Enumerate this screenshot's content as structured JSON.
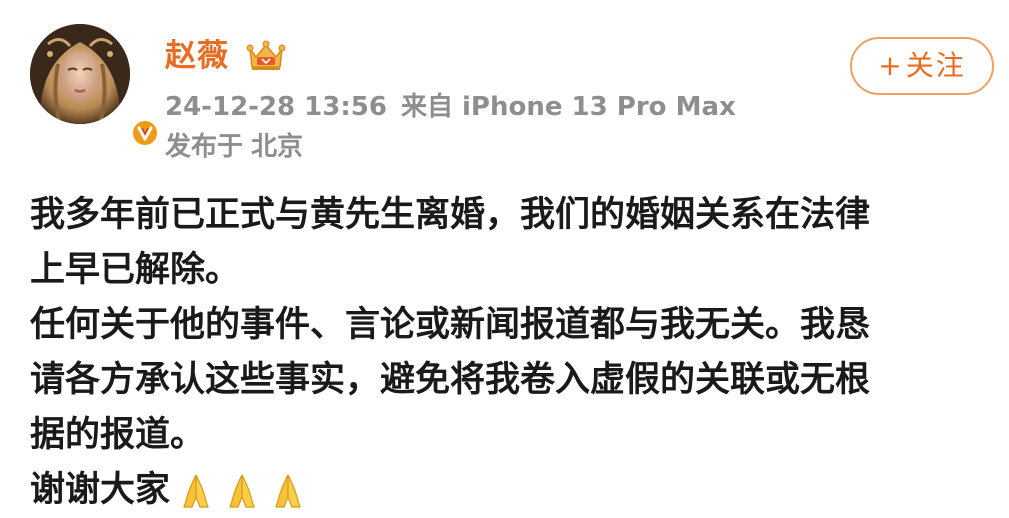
{
  "post": {
    "author": {
      "name": "赵薇",
      "avatar_icon": "avatar-image",
      "verified_icon": "verified-v-icon",
      "badge_icon": "crown-icon",
      "name_color": "#e86d22"
    },
    "meta": {
      "timestamp": "24-12-28 13:56",
      "source": "来自 iPhone 13 Pro Max",
      "location_prefix": "发布于",
      "location": "北京"
    },
    "follow_button": {
      "plus": "+",
      "label": "关注",
      "color": "#e86d22"
    },
    "content": {
      "lines": [
        "我多年前已正式与黄先生离婚，我们的婚姻关系在法律",
        "上早已解除。",
        "任何关于他的事件、言论或新闻报道都与我无关。我恳",
        "请各方承认这些事实，避免将我卷入虚假的关联或无根",
        "据的报道。",
        "谢谢大家"
      ],
      "trailing_icons": [
        "pray-icon",
        "pray-icon",
        "pray-icon"
      ]
    }
  }
}
